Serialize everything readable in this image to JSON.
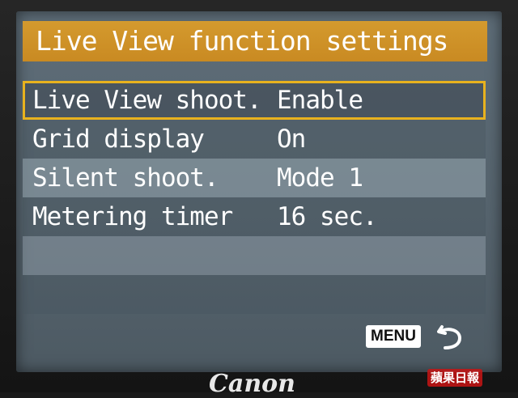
{
  "screen": {
    "title": "Live View function settings",
    "menu_items": [
      {
        "label": "Live View shoot.",
        "value": "Enable"
      },
      {
        "label": "Grid display",
        "value": "On"
      },
      {
        "label": "Silent shoot.",
        "value": "Mode 1"
      },
      {
        "label": "Metering timer",
        "value": "16 sec."
      }
    ],
    "selected_index": 0,
    "menu_button_label": "MENU",
    "return_icon": "return-arrow-icon"
  },
  "device": {
    "brand": "Canon"
  },
  "watermark": "蘋果日報",
  "colors": {
    "title_bar": "#c98a22",
    "selection_outline": "#e8b21e",
    "screen_bg": "#56646e"
  }
}
